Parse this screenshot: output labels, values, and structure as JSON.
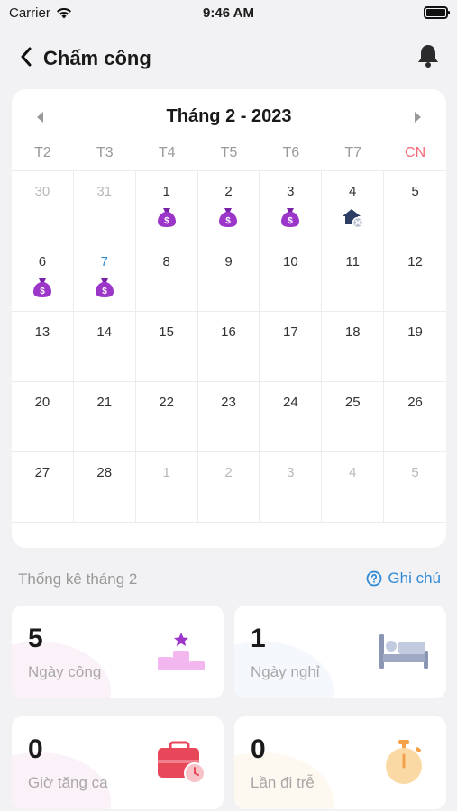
{
  "status_bar": {
    "carrier": "Carrier",
    "time": "9:46 AM"
  },
  "header": {
    "title": "Chấm công"
  },
  "calendar": {
    "title": "Tháng 2 - 2023",
    "weekdays": [
      "T2",
      "T3",
      "T4",
      "T5",
      "T6",
      "T7",
      "CN"
    ],
    "weeks": [
      [
        {
          "day": "30",
          "muted": true
        },
        {
          "day": "31",
          "muted": true
        },
        {
          "day": "1",
          "icon": "money-bag-icon"
        },
        {
          "day": "2",
          "icon": "money-bag-icon"
        },
        {
          "day": "3",
          "icon": "money-bag-icon"
        },
        {
          "day": "4",
          "icon": "home-leave-icon"
        },
        {
          "day": "5"
        }
      ],
      [
        {
          "day": "6",
          "icon": "money-bag-icon"
        },
        {
          "day": "7",
          "icon": "money-bag-icon",
          "today": true
        },
        {
          "day": "8"
        },
        {
          "day": "9"
        },
        {
          "day": "10"
        },
        {
          "day": "11"
        },
        {
          "day": "12"
        }
      ],
      [
        {
          "day": "13"
        },
        {
          "day": "14"
        },
        {
          "day": "15"
        },
        {
          "day": "16"
        },
        {
          "day": "17"
        },
        {
          "day": "18"
        },
        {
          "day": "19"
        }
      ],
      [
        {
          "day": "20"
        },
        {
          "day": "21"
        },
        {
          "day": "22"
        },
        {
          "day": "23"
        },
        {
          "day": "24"
        },
        {
          "day": "25"
        },
        {
          "day": "26"
        }
      ],
      [
        {
          "day": "27"
        },
        {
          "day": "28"
        },
        {
          "day": "1",
          "muted": true
        },
        {
          "day": "2",
          "muted": true
        },
        {
          "day": "3",
          "muted": true
        },
        {
          "day": "4",
          "muted": true
        },
        {
          "day": "5",
          "muted": true
        }
      ]
    ]
  },
  "stats": {
    "title": "Thống kê tháng 2",
    "notes_label": "Ghi chú",
    "cards": [
      {
        "value": "5",
        "label": "Ngày công",
        "icon": "podium-star-icon"
      },
      {
        "value": "1",
        "label": "Ngày nghỉ",
        "icon": "bed-icon"
      },
      {
        "value": "0",
        "label": "Giờ tăng ca",
        "icon": "briefcase-clock-icon"
      },
      {
        "value": "0",
        "label": "Lần đi trễ",
        "icon": "stopwatch-icon"
      }
    ]
  },
  "colors": {
    "accent": "#2f8bd8",
    "sunday": "#f36b7a",
    "money_bag": "#9b36c9"
  }
}
